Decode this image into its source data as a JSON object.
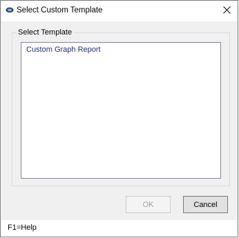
{
  "window": {
    "title": "Select Custom Template",
    "icon": "app-logo-icon",
    "close_glyph": "✕"
  },
  "template_group": {
    "label": "Select Template",
    "items": [
      {
        "label": "Custom Graph Report"
      }
    ]
  },
  "buttons": {
    "ok_label": "OK",
    "ok_enabled": false,
    "cancel_label": "Cancel"
  },
  "status": {
    "help_text": "F1=Help"
  },
  "colors": {
    "item_text": "#1f2f6f",
    "client_bg": "#f0f0f0",
    "disabled_text": "#a0a0a0"
  }
}
